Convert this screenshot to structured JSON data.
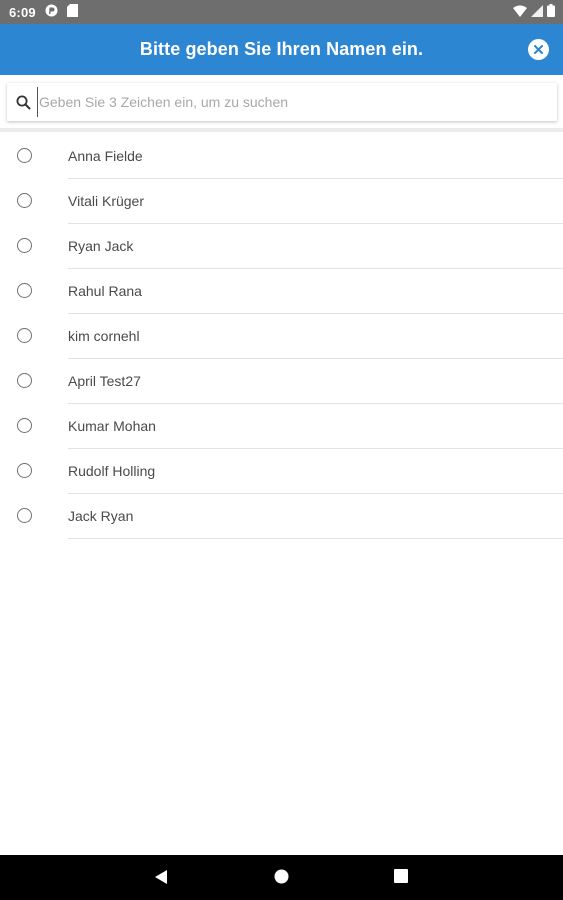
{
  "status_bar": {
    "time": "6:09"
  },
  "header": {
    "title": "Bitte geben Sie Ihren Namen ein."
  },
  "search": {
    "placeholder": "Geben Sie 3 Zeichen ein, um zu suchen",
    "value": ""
  },
  "names": [
    {
      "label": "Anna Fielde"
    },
    {
      "label": "Vitali Krüger"
    },
    {
      "label": "Ryan Jack"
    },
    {
      "label": "Rahul Rana"
    },
    {
      "label": "kim cornehl"
    },
    {
      "label": "April Test27"
    },
    {
      "label": "Kumar Mohan"
    },
    {
      "label": "Rudolf Holling"
    },
    {
      "label": "Jack Ryan"
    }
  ],
  "colors": {
    "app_bar": "#2d86d2",
    "status_bar": "#6e6e6e",
    "nav_bar": "#000000"
  }
}
